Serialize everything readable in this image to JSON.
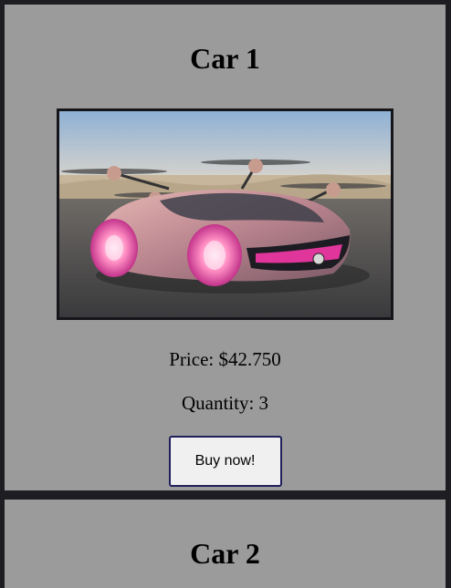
{
  "products": [
    {
      "title": "Car 1",
      "image_alt": "flying concept car",
      "price_label": "Price: $42.750",
      "quantity_label": "Quantity: 3",
      "buy_label": "Buy now!"
    },
    {
      "title": "Car 2"
    }
  ],
  "colors": {
    "page_background": "#1e1e22",
    "card_background": "#9b9b9b",
    "button_border": "#1f1f5c",
    "button_background": "#f0f0f0"
  }
}
